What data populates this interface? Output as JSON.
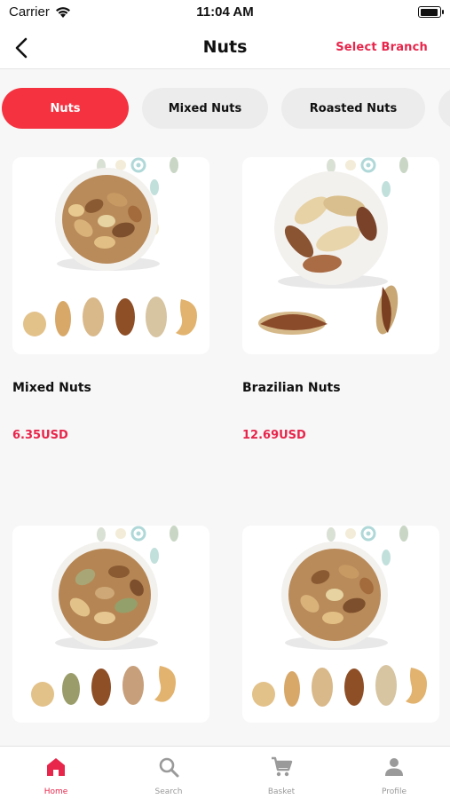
{
  "status_bar": {
    "carrier": "Carrier",
    "time": "11:04 AM"
  },
  "header": {
    "title": "Nuts",
    "select_branch": "Select Branch"
  },
  "categories": [
    {
      "label": "Nuts",
      "active": true
    },
    {
      "label": "Mixed Nuts",
      "active": false
    },
    {
      "label": "Roasted Nuts",
      "active": false
    },
    {
      "label": "",
      "active": false
    }
  ],
  "products": [
    {
      "name": "Mixed Nuts",
      "price": "6.35USD",
      "image": "mixed-nuts-bowl"
    },
    {
      "name": "Brazilian Nuts",
      "price": "12.69USD",
      "image": "brazil-nuts-bowl"
    },
    {
      "name": "",
      "price": "",
      "image": "mixed-nuts-bowl-with-pistachios"
    },
    {
      "name": "",
      "price": "",
      "image": "mixed-nuts-bowl"
    }
  ],
  "tab_bar": [
    {
      "label": "Home",
      "icon": "home-icon",
      "active": true
    },
    {
      "label": "Search",
      "icon": "search-icon",
      "active": false
    },
    {
      "label": "Basket",
      "icon": "cart-icon",
      "active": false
    },
    {
      "label": "Profile",
      "icon": "profile-icon",
      "active": false
    }
  ],
  "colors": {
    "accent": "#e8254b",
    "chip_active": "#f5323f",
    "chip_inactive": "#ececec",
    "background": "#f7f7f7"
  }
}
